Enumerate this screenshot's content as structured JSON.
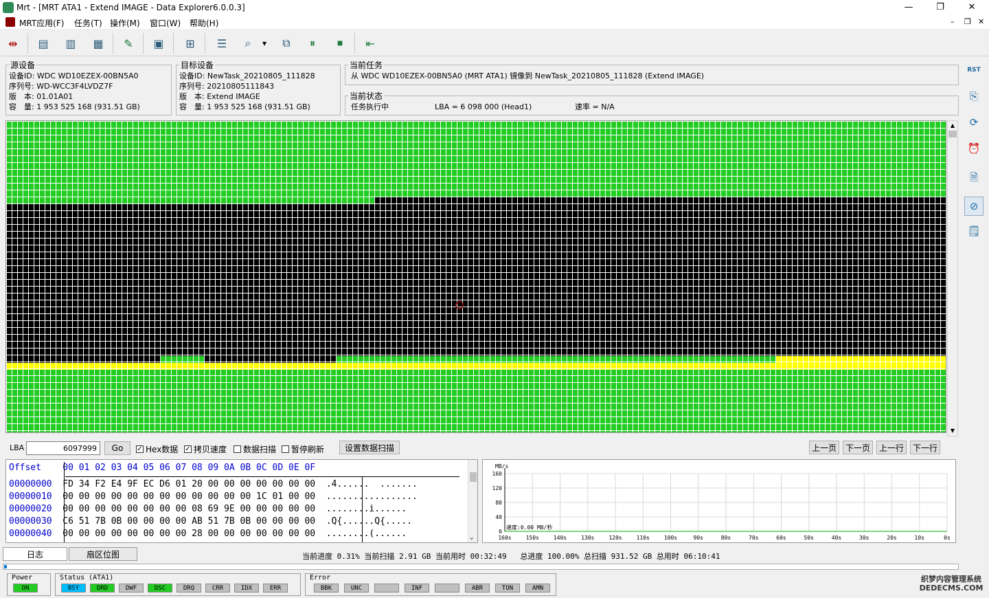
{
  "window": {
    "title": "Mrt - [MRT ATA1 - Extend IMAGE - Data Explorer6.0.0.3]",
    "minimize": "—",
    "maximize": "❐",
    "close": "✕",
    "mdi_min": "–",
    "mdi_restore": "❐",
    "mdi_close": "✕"
  },
  "menu": [
    "MRT应用(F)",
    "任务(T)",
    "操作(M)",
    "窗口(W)",
    "帮助(H)"
  ],
  "toolbar": {
    "icons": [
      "connect-icon",
      "doc-icon",
      "page-icon",
      "chart-icon",
      "edit-icon",
      "save-icon",
      "tree-icon",
      "report-icon",
      "search-doc-icon",
      "dropdown-icon",
      "copy-icon",
      "pause-icon",
      "stop-icon",
      "exit-icon"
    ],
    "glyphs": [
      "⇹",
      "▤",
      "▥",
      "▦",
      "✎",
      "▣",
      "⊞",
      "☰",
      "⌕",
      "▾",
      "⧉",
      "⏸",
      "⏹",
      "⇤"
    ]
  },
  "source": {
    "legend": "源设备",
    "device_id": "设备ID: WDC WD10EZEX-00BN5A0",
    "serial": "序列号: WD-WCC3F4LVDZ7F",
    "version": "版　本: 01.01A01",
    "capacity": "容　量: 1 953 525 168 (931.51 GB)"
  },
  "target": {
    "legend": "目标设备",
    "device_id": "设备ID: NewTask_20210805_111828",
    "serial": "序列号: 20210805111843",
    "version": "版　本: Extend IMAGE",
    "capacity": "容　量: 1 953 525 168 (931.51 GB)"
  },
  "current_task": {
    "legend": "当前任务",
    "text": "从 WDC WD10EZEX-00BN5A0 (MRT ATA1) 镜像到 NewTask_20210805_111828 (Extend IMAGE)"
  },
  "current_status": {
    "legend": "当前状态",
    "state": "任务执行中",
    "lba": "LBA = 6 098 000 (Head1)",
    "speed": "速率 = N/A"
  },
  "sector_map": {
    "colors": {
      "done": "#22cc22",
      "pending": "#000000",
      "reading": "#ffff00",
      "grid": "#ffffff"
    }
  },
  "lba_bar": {
    "label": "LBA",
    "value": "6097999",
    "go": "Go",
    "hex": "Hex数据",
    "copy_speed": "拷贝速度",
    "data_scan": "数据扫描",
    "pause_refresh": "暂停刷新",
    "set_scan": "设置数据扫描",
    "prev_page": "上一页",
    "next_page": "下一页",
    "prev_line": "上一行",
    "next_line": "下一行"
  },
  "hex": {
    "header": "Offset    00 01 02 03 04 05 06 07 08 09 0A 0B 0C 0D 0E 0F",
    "rows": [
      {
        "offset": "00000000",
        "bytes": "FD 34 F2 E4 9F EC D6 01 20 00 00 00 00 00 00 00",
        "ascii": ".4......  ......."
      },
      {
        "offset": "00000010",
        "bytes": "00 00 00 00 00 00 00 00 00 00 00 00 1C 01 00 00",
        "ascii": "................."
      },
      {
        "offset": "00000020",
        "bytes": "00 00 00 00 00 00 00 00 08 69 9E 00 00 00 00 00",
        "ascii": "........i......"
      },
      {
        "offset": "00000030",
        "bytes": "C6 51 7B 0B 00 00 00 00 AB 51 7B 0B 00 00 00 00",
        "ascii": ".Q{......Q{....."
      },
      {
        "offset": "00000040",
        "bytes": "00 00 00 00 00 00 00 00 28 00 00 00 00 00 00 00",
        "ascii": "........(......"
      }
    ]
  },
  "speed_chart": {
    "unit": "MB/s",
    "y_ticks": [
      "160",
      "120",
      "80",
      "40",
      "0"
    ],
    "x_ticks": [
      "160s",
      "150s",
      "140s",
      "130s",
      "120s",
      "110s",
      "100s",
      "90s",
      "80s",
      "70s",
      "60s",
      "50s",
      "40s",
      "30s",
      "20s",
      "10s",
      "0s"
    ],
    "speed_label": "速度:0.00 MB/秒"
  },
  "chart_data": {
    "type": "line",
    "ylabel": "MB/s",
    "ylim": [
      0,
      160
    ],
    "x": [
      "160s",
      "150s",
      "140s",
      "130s",
      "120s",
      "110s",
      "100s",
      "90s",
      "80s",
      "70s",
      "60s",
      "50s",
      "40s",
      "30s",
      "20s",
      "10s",
      "0s"
    ],
    "series": [
      {
        "values": [
          0,
          0,
          0,
          0,
          0,
          0,
          0,
          0,
          0,
          0,
          0,
          0,
          0,
          0,
          0,
          0,
          0
        ]
      }
    ],
    "grid": true
  },
  "tabs": {
    "log": "日志",
    "sector_map": "扇区位图"
  },
  "progress": {
    "line": "当前进度 0.31% 当前扫描 2.91 GB 当前用时 00:32:49   总进度 100.00% 总扫描 931.52 GB 总用时 06:10:41",
    "fraction": 0.0031
  },
  "status_panel": {
    "power_label": "Power",
    "power_leds": [
      {
        "text": "ON",
        "color": "#22cc22"
      }
    ],
    "status_label": "Status (ATA1)",
    "status_leds": [
      {
        "text": "BSY",
        "color": "#00bfff"
      },
      {
        "text": "DRD",
        "color": "#22cc22"
      },
      {
        "text": "DWF",
        "color": "#c0c0c0"
      },
      {
        "text": "DSC",
        "color": "#22cc22"
      },
      {
        "text": "DRQ",
        "color": "#c0c0c0"
      },
      {
        "text": "CRR",
        "color": "#c0c0c0"
      },
      {
        "text": "IDX",
        "color": "#c0c0c0"
      },
      {
        "text": "ERR",
        "color": "#c0c0c0"
      }
    ],
    "error_label": "Error",
    "error_leds": [
      {
        "text": "BBK",
        "color": "#c0c0c0"
      },
      {
        "text": "UNC",
        "color": "#c0c0c0"
      },
      {
        "text": "",
        "color": "#c0c0c0"
      },
      {
        "text": "INF",
        "color": "#c0c0c0"
      },
      {
        "text": "",
        "color": "#c0c0c0"
      },
      {
        "text": "ABR",
        "color": "#c0c0c0"
      },
      {
        "text": "TON",
        "color": "#c0c0c0"
      },
      {
        "text": "AMN",
        "color": "#c0c0c0"
      }
    ]
  },
  "sidebar": {
    "icons": [
      "reset-icon",
      "device-icon",
      "refresh-icon",
      "alarm-icon",
      "document-icon",
      "disk-error-icon",
      "log-icon"
    ],
    "rst_label": "RST",
    "glyphs": [
      "",
      "⎘",
      "⟳",
      "⏰",
      "🗎",
      "⊘",
      "🗒"
    ]
  },
  "watermark": {
    "line1": "织梦内容管理系统",
    "line2": "DEDECMS.COM"
  }
}
